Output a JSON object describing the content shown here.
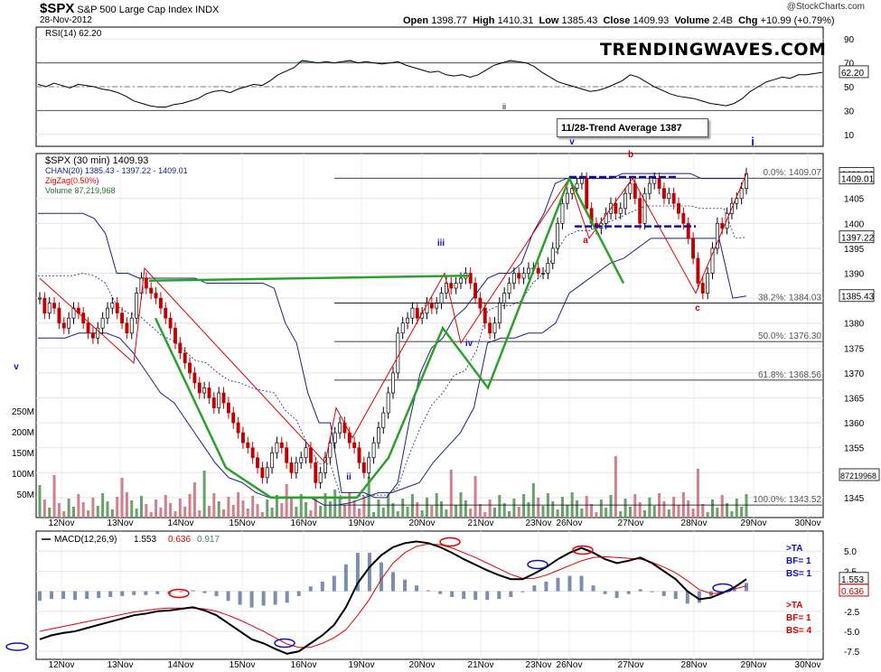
{
  "header": {
    "symbol": "$SPX",
    "name": "S&P 500 Large Cap Index",
    "exchange": "INDX",
    "date": "28-Nov-2012",
    "open_label": "Open",
    "open": "1398.77",
    "high_label": "High",
    "high": "1410.31",
    "low_label": "Low",
    "low": "1385.43",
    "close_label": "Close",
    "close": "1409.93",
    "volume_label": "Volume",
    "volume": "2.4B",
    "chg_label": "Chg",
    "chg": "+10.99 (+0.79%)",
    "credit": "@StockCharts.com"
  },
  "brand": "TRENDINGWAVES.COM",
  "trend_note": "11/28-Trend Average 1387",
  "colors": {
    "green_wave": "#2ca02c",
    "zigzag": "#e00000",
    "channel": "#1a237e",
    "rsi_fill": "#6a9ea0",
    "vol_up": "#6aa06a",
    "vol_down": "#d0808a",
    "macd_line": "#000000",
    "signal_line": "#e00000",
    "hist": "#7a8fb0",
    "blue_text": "#1010c0",
    "red_text": "#e00000"
  },
  "chart_data": [
    {
      "type": "line",
      "title": "RSI(14) 62.20",
      "legend": [
        "RSI(14) 62.20"
      ],
      "ylim": [
        0,
        100
      ],
      "y_ticks": [
        "10",
        "30",
        "50",
        "70",
        "90"
      ],
      "levels": [
        30,
        70
      ],
      "last_label": "62.20",
      "wave_label": "ii",
      "values": [
        52,
        50,
        53,
        51,
        49,
        52,
        51,
        50,
        48,
        47,
        45,
        42,
        38,
        36,
        34,
        33,
        33,
        35,
        36,
        38,
        40,
        44,
        46,
        47,
        45,
        48,
        50,
        52,
        51,
        55,
        60,
        63,
        66,
        72,
        71,
        70,
        71,
        70,
        71,
        72,
        70,
        71,
        70,
        69,
        70,
        71,
        68,
        66,
        64,
        62,
        63,
        60,
        59,
        60,
        58,
        60,
        64,
        68,
        70,
        72,
        71,
        70,
        67,
        62,
        58,
        54,
        52,
        50,
        48,
        46,
        47,
        49,
        52,
        55,
        60,
        58,
        54,
        50,
        47,
        44,
        42,
        41,
        40,
        38,
        36,
        35,
        34,
        36,
        40,
        46,
        50,
        54,
        56,
        58,
        57,
        60,
        60,
        61,
        62
      ]
    },
    {
      "type": "line",
      "title": "$SPX (30 min) 1409.93",
      "legend": [
        "$SPX (30 min) 1409.93",
        "CHAN(20) 1385.43 - 1397.22 - 1409.01",
        "ZigZag(0.50%)",
        "Volume 87,219,968"
      ],
      "ylim": [
        1341,
        1414
      ],
      "y_ticks": [
        "1345",
        "1350",
        "1355",
        "1360",
        "1365",
        "1370",
        "1375",
        "1380",
        "1385",
        "1390",
        "1395",
        "1400",
        "1405"
      ],
      "x_labels": [
        "12Nov",
        "13Nov",
        "14Nov",
        "15Nov",
        "16Nov",
        "19Nov",
        "20Nov",
        "21Nov",
        "23Nov",
        "26Nov",
        "27Nov",
        "28Nov",
        "29Nov",
        "30Nov"
      ],
      "volume_ticks": [
        "250M",
        "200M",
        "150M",
        "100M",
        "50M"
      ],
      "fibonacci": [
        {
          "label": "0.0%: 1409.07",
          "value": 1409.07
        },
        {
          "label": "38.2%: 1384.03",
          "value": 1384.03
        },
        {
          "label": "50.0%: 1376.30",
          "value": 1376.3
        },
        {
          "label": "61.8%: 1368.56",
          "value": 1368.56
        },
        {
          "label": "100.0%: 1343.52",
          "value": 1343.52
        }
      ],
      "price_tags": [
        "1409.93",
        "1409.01",
        "1397.22",
        "1385.43",
        "87219968"
      ],
      "wave_labels": [
        "v",
        "ii",
        "iii",
        "iv",
        "v",
        "a",
        "b",
        "c",
        "i"
      ],
      "close_series": [
        1385,
        1382,
        1384,
        1383,
        1380,
        1379,
        1381,
        1383,
        1382,
        1380,
        1378,
        1377,
        1379,
        1381,
        1383,
        1384,
        1382,
        1380,
        1378,
        1381,
        1386,
        1389,
        1387,
        1386,
        1385,
        1383,
        1381,
        1379,
        1376,
        1374,
        1372,
        1370,
        1368,
        1366,
        1367,
        1365,
        1363,
        1366,
        1364,
        1362,
        1360,
        1358,
        1356,
        1355,
        1353,
        1351,
        1349,
        1351,
        1354,
        1356,
        1355,
        1352,
        1350,
        1352,
        1353,
        1355,
        1352,
        1348,
        1350,
        1353,
        1356,
        1358,
        1360,
        1358,
        1356,
        1355,
        1352,
        1350,
        1353,
        1356,
        1359,
        1362,
        1366,
        1370,
        1378,
        1380,
        1381,
        1383,
        1381,
        1382,
        1384,
        1383,
        1384,
        1386,
        1388,
        1387,
        1388,
        1389,
        1390,
        1388,
        1385,
        1383,
        1380,
        1378,
        1380,
        1384,
        1386,
        1388,
        1390,
        1389,
        1390,
        1391,
        1391,
        1390,
        1390,
        1392,
        1395,
        1400,
        1404,
        1406,
        1407,
        1408,
        1409,
        1403,
        1400,
        1399,
        1400,
        1402,
        1404,
        1402,
        1403,
        1406,
        1408,
        1405,
        1400,
        1406,
        1408,
        1409,
        1407,
        1405,
        1406,
        1404,
        1402,
        1400,
        1397,
        1393,
        1388,
        1386,
        1390,
        1395,
        1400,
        1399,
        1402,
        1404,
        1405,
        1407,
        1409.93
      ],
      "channel_upper": [
        1402,
        1402,
        1402,
        1402,
        1402,
        1401,
        1398,
        1390,
        1390,
        1389,
        1389,
        1389,
        1389,
        1389,
        1389,
        1388,
        1388,
        1388,
        1388,
        1388,
        1388,
        1387,
        1380,
        1376,
        1366,
        1360,
        1360,
        1346,
        1346,
        1346,
        1345,
        1345,
        1348,
        1360,
        1370,
        1375,
        1377,
        1381,
        1383,
        1386,
        1389,
        1390,
        1390,
        1392,
        1398,
        1402,
        1408,
        1409,
        1409,
        1409,
        1409,
        1409,
        1410,
        1410,
        1410,
        1410,
        1410,
        1410,
        1410,
        1409,
        1409,
        1409,
        1409,
        1409.01
      ],
      "channel_lower": [
        1377,
        1377,
        1377,
        1378,
        1378,
        1378,
        1377,
        1374,
        1370,
        1366,
        1364,
        1360,
        1356,
        1352,
        1349,
        1348,
        1346,
        1345,
        1345,
        1345,
        1345,
        1343.5,
        1343.5,
        1344,
        1345,
        1346,
        1346,
        1347,
        1348,
        1352,
        1355,
        1358,
        1363,
        1376,
        1377,
        1377,
        1378,
        1378,
        1380,
        1386,
        1388,
        1390,
        1392,
        1393,
        1395,
        1397,
        1397,
        1397,
        1397,
        1397,
        1397,
        1385,
        1385.43
      ],
      "green_waves": [
        1381,
        1351,
        1345,
        1345,
        1353,
        1379,
        1367,
        1409,
        1388
      ],
      "zigzag": [
        1389,
        1372,
        1391,
        1352,
        1363,
        1357,
        1390,
        1376,
        1409,
        1397,
        1409,
        1386,
        1409.93
      ]
    },
    {
      "type": "line",
      "title": "MACD(12,26,9) 1.553, 0.636, 0.917",
      "legend": [
        "MACD(12,26,9)",
        "1.553",
        "0.636",
        "0.917"
      ],
      "ylim": [
        -8.5,
        7.5
      ],
      "y_ticks": [
        "5.0",
        "2.5",
        "0.0",
        "-2.5",
        "-5.0",
        "-7.5"
      ],
      "last_labels": [
        "1.553",
        "0.636"
      ],
      "macd": [
        -6,
        -5.5,
        -5.2,
        -5,
        -4.6,
        -4.2,
        -3.8,
        -3.4,
        -3,
        -2.8,
        -2.5,
        -2.4,
        -2.2,
        -2,
        -2.4,
        -3,
        -4,
        -5,
        -6,
        -6.5,
        -7.2,
        -7.8,
        -7.5,
        -6.5,
        -5.5,
        -4.2,
        -2,
        1,
        3,
        4.5,
        5.5,
        6,
        6.2,
        6,
        5.5,
        4.8,
        4,
        3.3,
        2.6,
        2,
        1.5,
        1.5,
        2.2,
        3,
        4,
        4.8,
        5.4,
        4.8,
        4,
        3.5,
        3.8,
        4.2,
        3.5,
        2.5,
        1.5,
        0,
        -1,
        -0.8,
        -0.2,
        0.5,
        1.5
      ],
      "signal": [
        -5,
        -4.7,
        -4.4,
        -4.1,
        -3.8,
        -3.5,
        -3.2,
        -2.9,
        -2.6,
        -2.4,
        -2.2,
        -2.1,
        -2.1,
        -2.1,
        -2.2,
        -2.5,
        -3,
        -3.6,
        -4.3,
        -5,
        -5.8,
        -6.6,
        -7,
        -7,
        -6.5,
        -5.8,
        -4.8,
        -3,
        -1,
        1.5,
        3.5,
        4.8,
        5.6,
        5.9,
        5.8,
        5.4,
        4.8,
        4.2,
        3.5,
        2.8,
        2.1,
        1.6,
        1.6,
        2,
        2.6,
        3.2,
        3.8,
        4.2,
        4.3,
        4.2,
        4.1,
        4,
        3.6,
        3,
        2.3,
        1.3,
        0.2,
        -0.3,
        -0.2,
        0.3,
        0.64
      ],
      "signal_boxes": [
        {
          "lines": [
            ">TA",
            "BF= 1",
            "BS= 1"
          ],
          "color": "blue"
        },
        {
          "lines": [
            ">TA",
            "BF= 1",
            "BS= 4"
          ],
          "color": "red"
        }
      ]
    }
  ]
}
